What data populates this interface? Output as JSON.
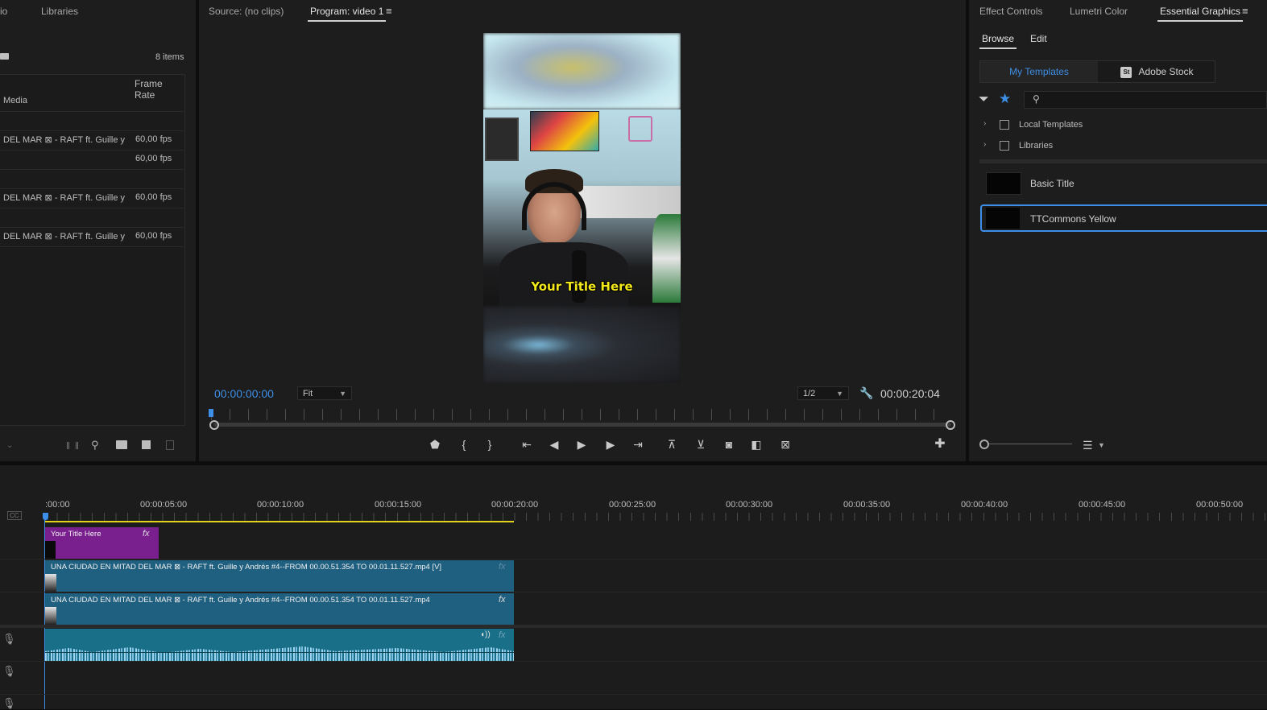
{
  "project_panel": {
    "tabs": [
      "io",
      "Libraries"
    ],
    "items_count": "8 items",
    "column_header": "Frame Rate",
    "rows": [
      {
        "name": "Media",
        "fps": ""
      },
      {
        "name": "",
        "fps": ""
      },
      {
        "name": "DEL MAR ⊠ - RAFT ft. Guille y",
        "fps": "60,00 fps"
      },
      {
        "name": "",
        "fps": "60,00 fps"
      },
      {
        "name": "",
        "fps": ""
      },
      {
        "name": "DEL MAR ⊠ - RAFT ft. Guille y",
        "fps": "60,00 fps"
      },
      {
        "name": "",
        "fps": ""
      },
      {
        "name": "DEL MAR ⊠ - RAFT ft. Guille y",
        "fps": "60,00 fps"
      }
    ]
  },
  "monitor": {
    "source_tab": "Source: (no clips)",
    "program_tab": "Program: video 1",
    "menu_icon": "≡",
    "current_timecode": "00:00:00:00",
    "fit_select": "Fit",
    "resolution_select": "1/2",
    "duration_timecode": "00:00:20:04",
    "video_title_overlay": "Your Title Here",
    "playhead_fraction": 0
  },
  "essential_graphics": {
    "tabs": [
      "Effect Controls",
      "Lumetri Color",
      "Essential Graphics"
    ],
    "menu_icon": "≡",
    "subtabs": [
      "Browse",
      "Edit"
    ],
    "source_buttons": [
      "My Templates",
      "Adobe Stock"
    ],
    "stock_badge": "St",
    "search_placeholder": "",
    "folders": [
      "Local Templates",
      "Libraries"
    ],
    "templates": [
      "Basic Title",
      "TTCommons Yellow"
    ]
  },
  "timeline": {
    "ruler_labels": [
      ":00:00",
      "00:00:05:00",
      "00:00:10:00",
      "00:00:15:00",
      "00:00:20:00",
      "00:00:25:00",
      "00:00:30:00",
      "00:00:35:00",
      "00:00:40:00",
      "00:00:45:00",
      "00:00:50:00"
    ],
    "cc_label": "CC",
    "clips": {
      "title": "Your Title Here",
      "video1": "UNA CIUDAD EN MITAD DEL MAR ⊠ - RAFT ft. Guille y Andrés #4--FROM 00.00.51.354 TO 00.01.11.527.mp4 [V]",
      "video2": "UNA CIUDAD EN MITAD DEL MAR ⊠ - RAFT ft. Guille y Andrés #4--FROM 00.00.51.354 TO 00.01.11.527.mp4",
      "fx": "fx"
    }
  },
  "colors": {
    "accent_blue": "#3d8ee6",
    "title_clip": "#7a1f8e",
    "video_clip": "#1f5f7f",
    "audio_clip": "#1a6f88",
    "work_area": "#e3d21a"
  }
}
